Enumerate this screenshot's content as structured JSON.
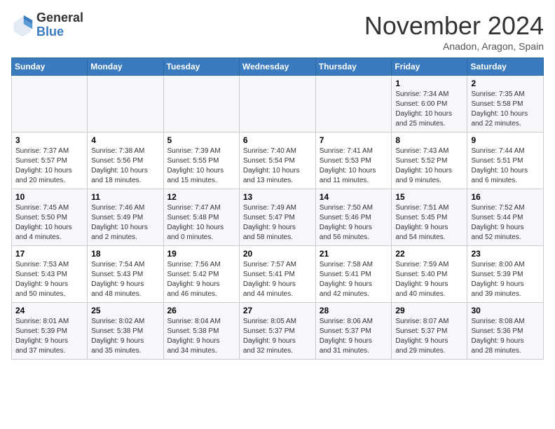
{
  "header": {
    "logo": {
      "line1": "General",
      "line2": "Blue"
    },
    "title": "November 2024",
    "location": "Anadon, Aragon, Spain"
  },
  "weekdays": [
    "Sunday",
    "Monday",
    "Tuesday",
    "Wednesday",
    "Thursday",
    "Friday",
    "Saturday"
  ],
  "weeks": [
    [
      {
        "day": "",
        "info": ""
      },
      {
        "day": "",
        "info": ""
      },
      {
        "day": "",
        "info": ""
      },
      {
        "day": "",
        "info": ""
      },
      {
        "day": "",
        "info": ""
      },
      {
        "day": "1",
        "info": "Sunrise: 7:34 AM\nSunset: 6:00 PM\nDaylight: 10 hours\nand 25 minutes."
      },
      {
        "day": "2",
        "info": "Sunrise: 7:35 AM\nSunset: 5:58 PM\nDaylight: 10 hours\nand 22 minutes."
      }
    ],
    [
      {
        "day": "3",
        "info": "Sunrise: 7:37 AM\nSunset: 5:57 PM\nDaylight: 10 hours\nand 20 minutes."
      },
      {
        "day": "4",
        "info": "Sunrise: 7:38 AM\nSunset: 5:56 PM\nDaylight: 10 hours\nand 18 minutes."
      },
      {
        "day": "5",
        "info": "Sunrise: 7:39 AM\nSunset: 5:55 PM\nDaylight: 10 hours\nand 15 minutes."
      },
      {
        "day": "6",
        "info": "Sunrise: 7:40 AM\nSunset: 5:54 PM\nDaylight: 10 hours\nand 13 minutes."
      },
      {
        "day": "7",
        "info": "Sunrise: 7:41 AM\nSunset: 5:53 PM\nDaylight: 10 hours\nand 11 minutes."
      },
      {
        "day": "8",
        "info": "Sunrise: 7:43 AM\nSunset: 5:52 PM\nDaylight: 10 hours\nand 9 minutes."
      },
      {
        "day": "9",
        "info": "Sunrise: 7:44 AM\nSunset: 5:51 PM\nDaylight: 10 hours\nand 6 minutes."
      }
    ],
    [
      {
        "day": "10",
        "info": "Sunrise: 7:45 AM\nSunset: 5:50 PM\nDaylight: 10 hours\nand 4 minutes."
      },
      {
        "day": "11",
        "info": "Sunrise: 7:46 AM\nSunset: 5:49 PM\nDaylight: 10 hours\nand 2 minutes."
      },
      {
        "day": "12",
        "info": "Sunrise: 7:47 AM\nSunset: 5:48 PM\nDaylight: 10 hours\nand 0 minutes."
      },
      {
        "day": "13",
        "info": "Sunrise: 7:49 AM\nSunset: 5:47 PM\nDaylight: 9 hours\nand 58 minutes."
      },
      {
        "day": "14",
        "info": "Sunrise: 7:50 AM\nSunset: 5:46 PM\nDaylight: 9 hours\nand 56 minutes."
      },
      {
        "day": "15",
        "info": "Sunrise: 7:51 AM\nSunset: 5:45 PM\nDaylight: 9 hours\nand 54 minutes."
      },
      {
        "day": "16",
        "info": "Sunrise: 7:52 AM\nSunset: 5:44 PM\nDaylight: 9 hours\nand 52 minutes."
      }
    ],
    [
      {
        "day": "17",
        "info": "Sunrise: 7:53 AM\nSunset: 5:43 PM\nDaylight: 9 hours\nand 50 minutes."
      },
      {
        "day": "18",
        "info": "Sunrise: 7:54 AM\nSunset: 5:43 PM\nDaylight: 9 hours\nand 48 minutes."
      },
      {
        "day": "19",
        "info": "Sunrise: 7:56 AM\nSunset: 5:42 PM\nDaylight: 9 hours\nand 46 minutes."
      },
      {
        "day": "20",
        "info": "Sunrise: 7:57 AM\nSunset: 5:41 PM\nDaylight: 9 hours\nand 44 minutes."
      },
      {
        "day": "21",
        "info": "Sunrise: 7:58 AM\nSunset: 5:41 PM\nDaylight: 9 hours\nand 42 minutes."
      },
      {
        "day": "22",
        "info": "Sunrise: 7:59 AM\nSunset: 5:40 PM\nDaylight: 9 hours\nand 40 minutes."
      },
      {
        "day": "23",
        "info": "Sunrise: 8:00 AM\nSunset: 5:39 PM\nDaylight: 9 hours\nand 39 minutes."
      }
    ],
    [
      {
        "day": "24",
        "info": "Sunrise: 8:01 AM\nSunset: 5:39 PM\nDaylight: 9 hours\nand 37 minutes."
      },
      {
        "day": "25",
        "info": "Sunrise: 8:02 AM\nSunset: 5:38 PM\nDaylight: 9 hours\nand 35 minutes."
      },
      {
        "day": "26",
        "info": "Sunrise: 8:04 AM\nSunset: 5:38 PM\nDaylight: 9 hours\nand 34 minutes."
      },
      {
        "day": "27",
        "info": "Sunrise: 8:05 AM\nSunset: 5:37 PM\nDaylight: 9 hours\nand 32 minutes."
      },
      {
        "day": "28",
        "info": "Sunrise: 8:06 AM\nSunset: 5:37 PM\nDaylight: 9 hours\nand 31 minutes."
      },
      {
        "day": "29",
        "info": "Sunrise: 8:07 AM\nSunset: 5:37 PM\nDaylight: 9 hours\nand 29 minutes."
      },
      {
        "day": "30",
        "info": "Sunrise: 8:08 AM\nSunset: 5:36 PM\nDaylight: 9 hours\nand 28 minutes."
      }
    ]
  ]
}
